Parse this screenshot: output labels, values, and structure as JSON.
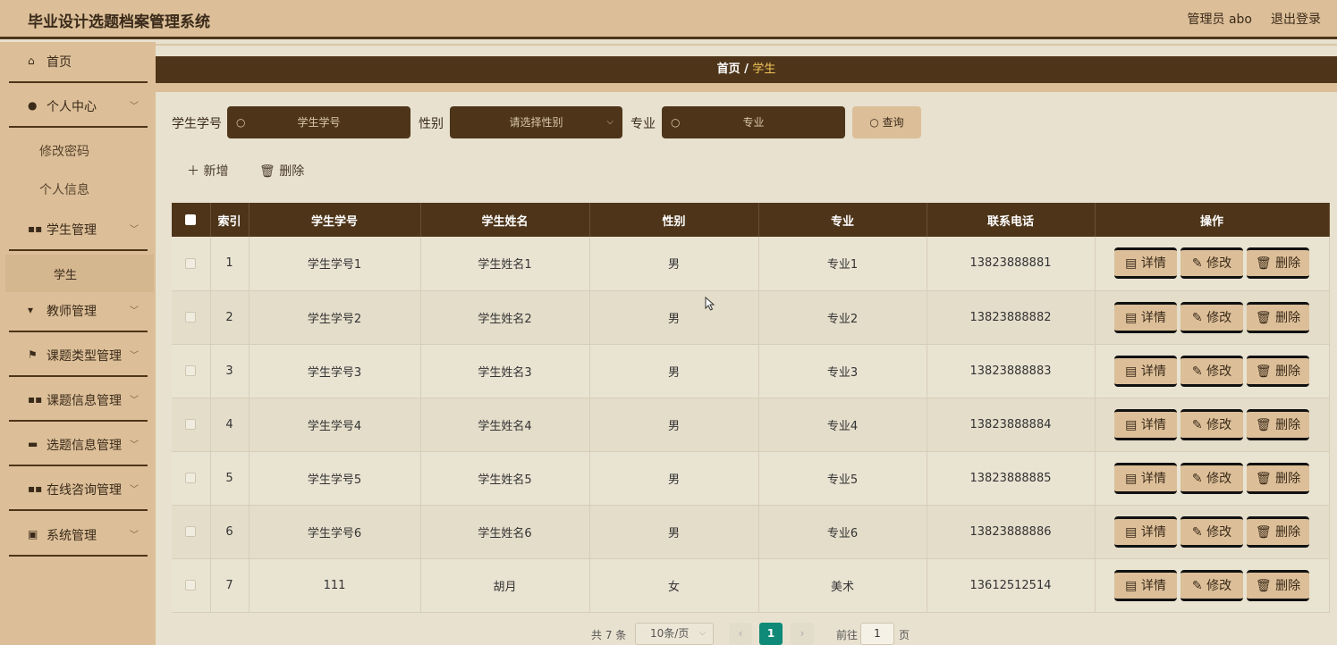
{
  "app": {
    "title": "毕业设计选题档案管理系统",
    "user": "管理员 abo",
    "logout": "退出登录"
  },
  "sidebar": {
    "items": [
      {
        "label": "首页",
        "icon": "home-icon",
        "glyph": "⌂"
      },
      {
        "label": "个人中心",
        "icon": "user-icon",
        "glyph": "●"
      },
      {
        "label": "学生管理",
        "icon": "grid-icon",
        "glyph": "▪▪"
      },
      {
        "label": "教师管理",
        "icon": "teacher-icon",
        "glyph": "▾"
      },
      {
        "label": "课题类型管理",
        "icon": "flag-icon",
        "glyph": "⚑"
      },
      {
        "label": "课题信息管理",
        "icon": "grid-icon",
        "glyph": "▪▪"
      },
      {
        "label": "选题信息管理",
        "icon": "briefcase-icon",
        "glyph": "▬"
      },
      {
        "label": "在线咨询管理",
        "icon": "grid-icon",
        "glyph": "▪▪"
      },
      {
        "label": "系统管理",
        "icon": "clipboard-icon",
        "glyph": "▣"
      }
    ],
    "sub_personal": [
      "修改密码",
      "个人信息"
    ],
    "sub_student": [
      "学生"
    ],
    "chevron": "﹀"
  },
  "breadcrumb": {
    "home": "首页",
    "sep": " / ",
    "current": "学生"
  },
  "search": {
    "student_no_label": "学生学号",
    "student_no_placeholder": "学生学号",
    "gender_label": "性别",
    "gender_placeholder": "请选择性别",
    "major_label": "专业",
    "major_placeholder": "专业",
    "query_button": "查询",
    "search_glyph": "○",
    "dropdown_glyph": "⌵"
  },
  "actions": {
    "add": "＋ 新增",
    "delete": "🗑 删除"
  },
  "table": {
    "headers": [
      "索引",
      "学生学号",
      "学生姓名",
      "性别",
      "专业",
      "联系电话",
      "操作"
    ],
    "rows": [
      {
        "index": "1",
        "no": "学生学号1",
        "name": "学生姓名1",
        "gender": "男",
        "major": "专业1",
        "phone": "13823888881"
      },
      {
        "index": "2",
        "no": "学生学号2",
        "name": "学生姓名2",
        "gender": "男",
        "major": "专业2",
        "phone": "13823888882"
      },
      {
        "index": "3",
        "no": "学生学号3",
        "name": "学生姓名3",
        "gender": "男",
        "major": "专业3",
        "phone": "13823888883"
      },
      {
        "index": "4",
        "no": "学生学号4",
        "name": "学生姓名4",
        "gender": "男",
        "major": "专业4",
        "phone": "13823888884"
      },
      {
        "index": "5",
        "no": "学生学号5",
        "name": "学生姓名5",
        "gender": "男",
        "major": "专业5",
        "phone": "13823888885"
      },
      {
        "index": "6",
        "no": "学生学号6",
        "name": "学生姓名6",
        "gender": "男",
        "major": "专业6",
        "phone": "13823888886"
      },
      {
        "index": "7",
        "no": "111",
        "name": "胡月",
        "gender": "女",
        "major": "美术",
        "phone": "13612512514"
      }
    ],
    "row_buttons": {
      "detail": "▤ 详情",
      "edit": "✎ 修改",
      "delete": "🗑 删除"
    }
  },
  "pagination": {
    "total": "共 7 条",
    "page_size": "10条/页",
    "prev": "‹",
    "current": "1",
    "next": "›",
    "goto": "前往",
    "goto_value": "1",
    "page_unit": "页"
  }
}
